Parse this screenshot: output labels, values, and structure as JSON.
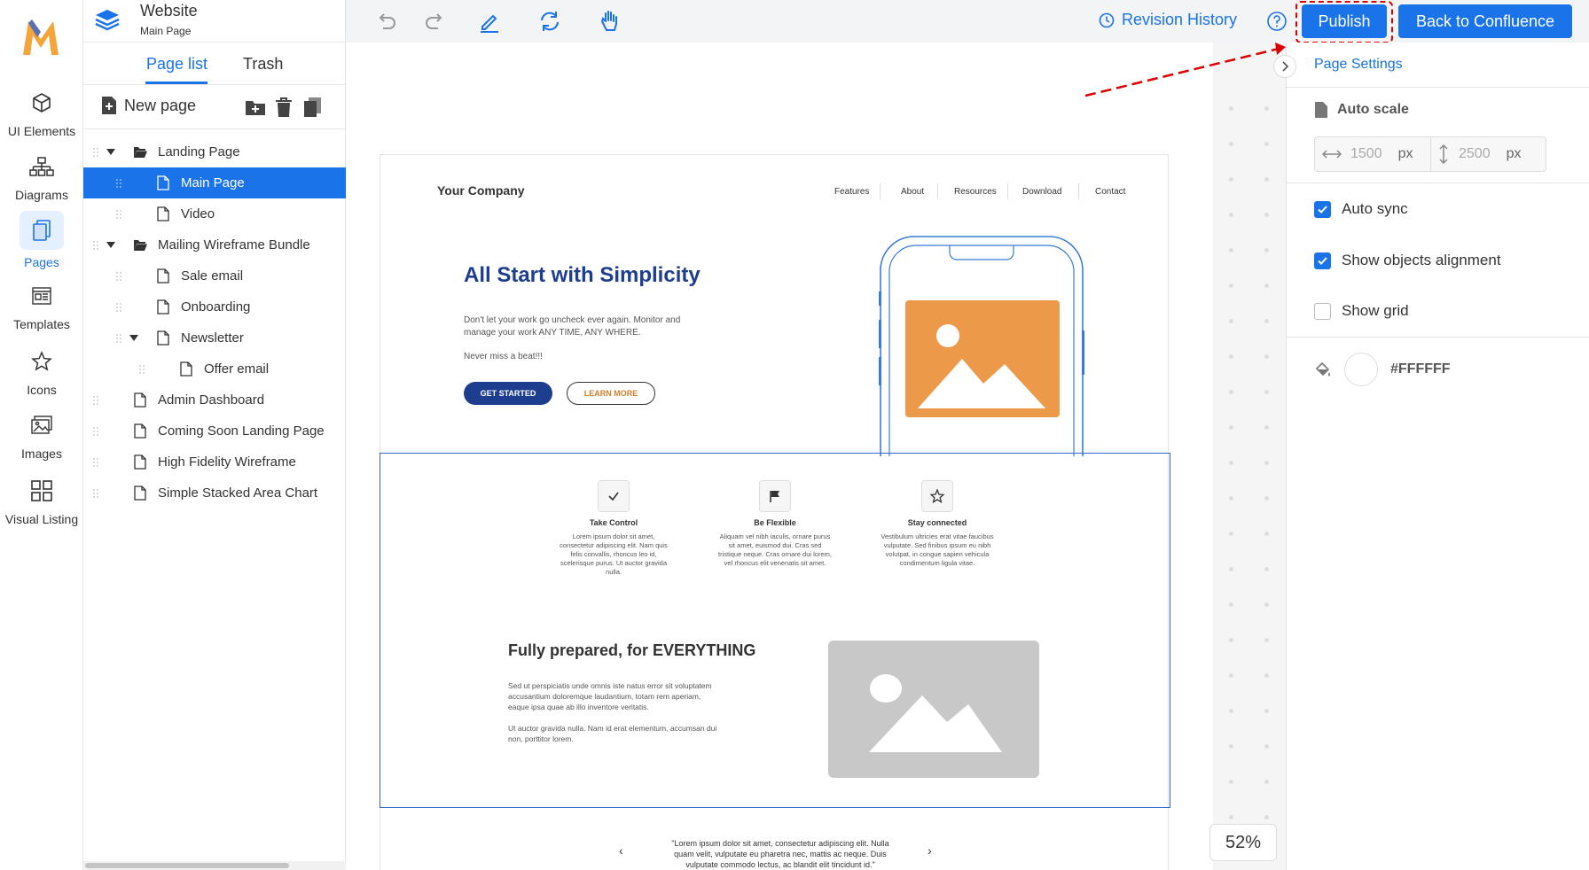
{
  "rail": {
    "items": [
      {
        "label": "UI Elements",
        "icon": "cube-icon"
      },
      {
        "label": "Diagrams",
        "icon": "diagram-icon"
      },
      {
        "label": "Pages",
        "icon": "pages-icon",
        "active": true
      },
      {
        "label": "Templates",
        "icon": "templates-icon"
      },
      {
        "label": "Icons",
        "icon": "star-icon"
      },
      {
        "label": "Images",
        "icon": "images-icon"
      },
      {
        "label": "Visual Listing",
        "icon": "grid-icon"
      }
    ]
  },
  "panel": {
    "title": "Website",
    "subtitle": "Main Page",
    "tabs": [
      {
        "label": "Page list",
        "active": true
      },
      {
        "label": "Trash"
      }
    ],
    "new_page_label": "New page",
    "tree": [
      {
        "label": "Landing Page",
        "type": "folder",
        "expanded": true,
        "depth": 0
      },
      {
        "label": "Main Page",
        "type": "page",
        "depth": 1,
        "selected": true
      },
      {
        "label": "Video",
        "type": "page",
        "depth": 1
      },
      {
        "label": "Mailing Wireframe Bundle",
        "type": "folder",
        "expanded": true,
        "depth": 0
      },
      {
        "label": "Sale email",
        "type": "page",
        "depth": 1
      },
      {
        "label": "Onboarding",
        "type": "page",
        "depth": 1
      },
      {
        "label": "Newsletter",
        "type": "page",
        "expanded": true,
        "depth": 1
      },
      {
        "label": "Offer email",
        "type": "page",
        "depth": 2
      },
      {
        "label": "Admin Dashboard",
        "type": "page",
        "depth": 0
      },
      {
        "label": "Coming Soon Landing Page",
        "type": "page",
        "depth": 0
      },
      {
        "label": "High Fidelity Wireframe",
        "type": "page",
        "depth": 0
      },
      {
        "label": "Simple Stacked Area Chart",
        "type": "page",
        "depth": 0
      }
    ]
  },
  "topbar": {
    "revision_label": "Revision History",
    "publish_label": "Publish",
    "back_label": "Back to Confluence"
  },
  "artboard": {
    "company": "Your Company",
    "nav": [
      "Features",
      "About",
      "Resources",
      "Download",
      "Contact"
    ],
    "hero_title": "All Start with Simplicity",
    "hero_text": "Don't let your work go uncheck ever again. Monitor and manage your work ANY TIME, ANY WHERE.",
    "hero_text2": "Never miss a beat!!!",
    "btn_start": "GET STARTED",
    "btn_learn": "LEARN MORE",
    "features": [
      {
        "title": "Take Control",
        "icon": "check-icon",
        "desc": "Lorem ipsum dolor sit amet, consectetur adipiscing elit. Nam quis felis convallis, rhoncus leo id, scelerisque purus. Ut auctor gravida nulla."
      },
      {
        "title": "Be Flexible",
        "icon": "flag-icon",
        "desc": "Aliquam vel nibh iaculis, ornare purus sit amet, euismod dui. Cras sed tristique neque. Cras ornare dui lorem, vel rhoncus elit venenatis sit amet."
      },
      {
        "title": "Stay connected",
        "icon": "star-icon",
        "desc": "Vestibulum ultricies erat vitae faucibus vulputate. Sed finibus ipsum eu nibh volutpat, in congue sapien vehicula condimentum ligula vitae."
      }
    ],
    "prepared_title": "Fully prepared, for EVERYTHING",
    "prepared_text": "Sed ut perspiciatis unde omnis iste natus error sit voluptatem accusantium doloremque laudantium, totam rem aperiam, eaque ipsa quae ab illo inventore veritatis.",
    "prepared_text2": "Ut auctor gravida nulla. Nam id erat elementum, accumsan dui non, porttitor lorem.",
    "quote": "\"Lorem ipsum dolor sit amet, consectetur adipiscing elit. Nulla quam velit, vulputate eu pharetra nec, mattis ac neque. Duis vulputate commodo lectus, ac blandit elit tincidunt id.\""
  },
  "zoom": "52%",
  "settings": {
    "title": "Page Settings",
    "autoscale_label": "Auto scale",
    "width": "1500",
    "height": "2500",
    "unit": "px",
    "checkboxes": [
      {
        "label": "Auto sync",
        "checked": true
      },
      {
        "label": "Show objects alignment",
        "checked": true
      },
      {
        "label": "Show grid",
        "checked": false
      }
    ],
    "bg_color": "#FFFFFF"
  },
  "colors": {
    "accent": "#1a73e8",
    "hero": "#1d3d8f",
    "orange": "#ec9a4a",
    "highlight": "#dd0000"
  }
}
